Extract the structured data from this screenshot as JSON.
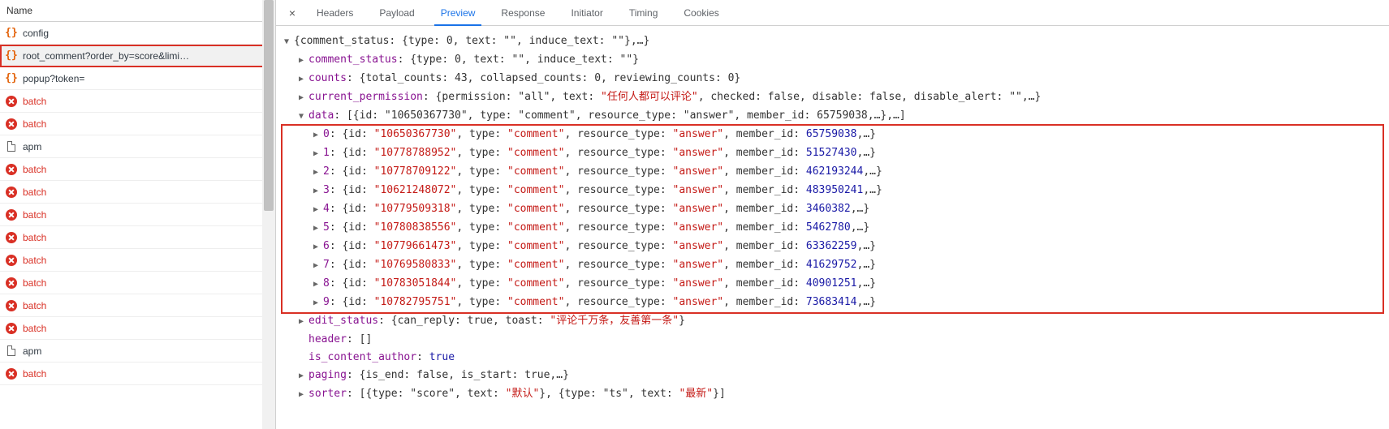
{
  "left": {
    "header": "Name",
    "requests": [
      {
        "icon": "json",
        "label": "config",
        "selected": false,
        "error": false
      },
      {
        "icon": "json",
        "label": "root_comment?order_by=score&limi…",
        "selected": true,
        "error": false
      },
      {
        "icon": "json",
        "label": "popup?token=",
        "selected": false,
        "error": false
      },
      {
        "icon": "error",
        "label": "batch",
        "selected": false,
        "error": true
      },
      {
        "icon": "error",
        "label": "batch",
        "selected": false,
        "error": true
      },
      {
        "icon": "doc",
        "label": "apm",
        "selected": false,
        "error": false
      },
      {
        "icon": "error",
        "label": "batch",
        "selected": false,
        "error": true
      },
      {
        "icon": "error",
        "label": "batch",
        "selected": false,
        "error": true
      },
      {
        "icon": "error",
        "label": "batch",
        "selected": false,
        "error": true
      },
      {
        "icon": "error",
        "label": "batch",
        "selected": false,
        "error": true
      },
      {
        "icon": "error",
        "label": "batch",
        "selected": false,
        "error": true
      },
      {
        "icon": "error",
        "label": "batch",
        "selected": false,
        "error": true
      },
      {
        "icon": "error",
        "label": "batch",
        "selected": false,
        "error": true
      },
      {
        "icon": "error",
        "label": "batch",
        "selected": false,
        "error": true
      },
      {
        "icon": "doc",
        "label": "apm",
        "selected": false,
        "error": false
      },
      {
        "icon": "error",
        "label": "batch",
        "selected": false,
        "error": true
      }
    ]
  },
  "tabs": {
    "close": "×",
    "items": [
      "Headers",
      "Payload",
      "Preview",
      "Response",
      "Initiator",
      "Timing",
      "Cookies"
    ],
    "active": 2
  },
  "preview": {
    "root_summary": "{comment_status: {type: 0, text: \"\", induce_text: \"\"},…}",
    "comment_status_key": "comment_status",
    "comment_status_val": "{type: 0, text: \"\", induce_text: \"\"}",
    "counts_key": "counts",
    "counts_val": "{total_counts: 43, collapsed_counts: 0, reviewing_counts: 0}",
    "current_permission_key": "current_permission",
    "current_permission_val_prefix": "{permission: \"all\", text: ",
    "current_permission_cn": "\"任何人都可以评论\"",
    "current_permission_val_suffix": ", checked: false, disable: false, disable_alert: \"\",…}",
    "data_key": "data",
    "data_summary": "[{id: \"10650367730\", type: \"comment\", resource_type: \"answer\", member_id: 65759038,…},…]",
    "data_items": [
      {
        "idx": "0",
        "id": "10650367730",
        "type": "comment",
        "resource_type": "answer",
        "member_id": "65759038"
      },
      {
        "idx": "1",
        "id": "10778788952",
        "type": "comment",
        "resource_type": "answer",
        "member_id": "51527430"
      },
      {
        "idx": "2",
        "id": "10778709122",
        "type": "comment",
        "resource_type": "answer",
        "member_id": "462193244"
      },
      {
        "idx": "3",
        "id": "10621248072",
        "type": "comment",
        "resource_type": "answer",
        "member_id": "483950241"
      },
      {
        "idx": "4",
        "id": "10779509318",
        "type": "comment",
        "resource_type": "answer",
        "member_id": "3460382"
      },
      {
        "idx": "5",
        "id": "10780838556",
        "type": "comment",
        "resource_type": "answer",
        "member_id": "5462780"
      },
      {
        "idx": "6",
        "id": "10779661473",
        "type": "comment",
        "resource_type": "answer",
        "member_id": "63362259"
      },
      {
        "idx": "7",
        "id": "10769580833",
        "type": "comment",
        "resource_type": "answer",
        "member_id": "41629752"
      },
      {
        "idx": "8",
        "id": "10783051844",
        "type": "comment",
        "resource_type": "answer",
        "member_id": "40901251"
      },
      {
        "idx": "9",
        "id": "10782795751",
        "type": "comment",
        "resource_type": "answer",
        "member_id": "73683414"
      }
    ],
    "edit_status_key": "edit_status",
    "edit_status_prefix": "{can_reply: true, toast: ",
    "edit_status_cn": "\"评论千万条，友善第一条\"",
    "edit_status_suffix": "}",
    "header_key": "header",
    "header_val": "[]",
    "is_content_author_key": "is_content_author",
    "is_content_author_val": "true",
    "paging_key": "paging",
    "paging_val": "{is_end: false, is_start: true,…}",
    "sorter_key": "sorter",
    "sorter_prefix": "[{type: \"score\", text: ",
    "sorter_cn1": "\"默认\"",
    "sorter_mid": "}, {type: \"ts\", text: ",
    "sorter_cn2": "\"最新\"",
    "sorter_suffix": "}]"
  }
}
